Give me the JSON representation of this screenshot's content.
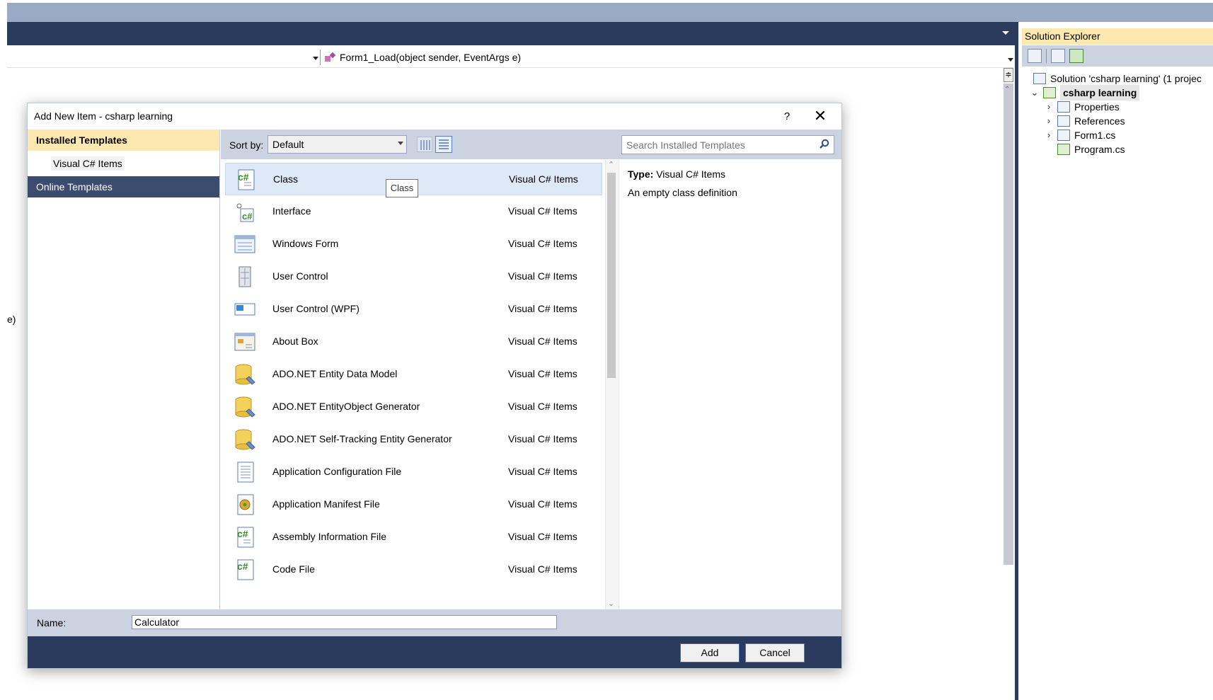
{
  "ide": {
    "method_combo": "Form1_Load(object sender, EventArgs e)",
    "partial_text": "e)"
  },
  "solution_explorer": {
    "title": "Solution Explorer",
    "solution": "Solution 'csharp learning' (1 projec",
    "project": "csharp learning",
    "items": [
      {
        "label": "Properties",
        "expandable": true
      },
      {
        "label": "References",
        "expandable": true
      },
      {
        "label": "Form1.cs",
        "expandable": true
      },
      {
        "label": "Program.cs",
        "expandable": false
      }
    ]
  },
  "dialog": {
    "title": "Add New Item - csharp learning",
    "help": "?",
    "close": "✕",
    "left_pane": {
      "installed": "Installed Templates",
      "visual_csharp": "Visual C# Items",
      "online": "Online Templates"
    },
    "sort_label": "Sort by:",
    "sort_value": "Default",
    "search_placeholder": "Search Installed Templates",
    "tooltip": "Class",
    "items": [
      {
        "name": "Class",
        "category": "Visual C# Items",
        "icon": "class-icon",
        "selected": true
      },
      {
        "name": "Interface",
        "category": "Visual C# Items",
        "icon": "interface-icon"
      },
      {
        "name": "Windows Form",
        "category": "Visual C# Items",
        "icon": "windows-form-icon"
      },
      {
        "name": "User Control",
        "category": "Visual C# Items",
        "icon": "user-control-icon"
      },
      {
        "name": "User Control (WPF)",
        "category": "Visual C# Items",
        "icon": "user-control-wpf-icon"
      },
      {
        "name": "About Box",
        "category": "Visual C# Items",
        "icon": "about-box-icon"
      },
      {
        "name": "ADO.NET Entity Data Model",
        "category": "Visual C# Items",
        "icon": "database-icon"
      },
      {
        "name": "ADO.NET EntityObject Generator",
        "category": "Visual C# Items",
        "icon": "database-icon"
      },
      {
        "name": "ADO.NET Self-Tracking Entity Generator",
        "category": "Visual C# Items",
        "icon": "database-icon"
      },
      {
        "name": "Application Configuration File",
        "category": "Visual C# Items",
        "icon": "config-file-icon"
      },
      {
        "name": "Application Manifest File",
        "category": "Visual C# Items",
        "icon": "manifest-file-icon"
      },
      {
        "name": "Assembly Information File",
        "category": "Visual C# Items",
        "icon": "csharp-file-icon"
      },
      {
        "name": "Code File",
        "category": "Visual C# Items",
        "icon": "code-file-icon"
      }
    ],
    "detail": {
      "type_label": "Type:",
      "type_value": "Visual C# Items",
      "description": "An empty class definition"
    },
    "name_label": "Name:",
    "name_value": "Calculator",
    "add_label": "Add",
    "cancel_label": "Cancel"
  },
  "colors": {
    "chrome_dark": "#2b3b5e",
    "title_band": "#9aa9c4",
    "highlight": "#fde9b0",
    "panel": "#ccd3e0",
    "selected_row": "#dde9f7"
  }
}
